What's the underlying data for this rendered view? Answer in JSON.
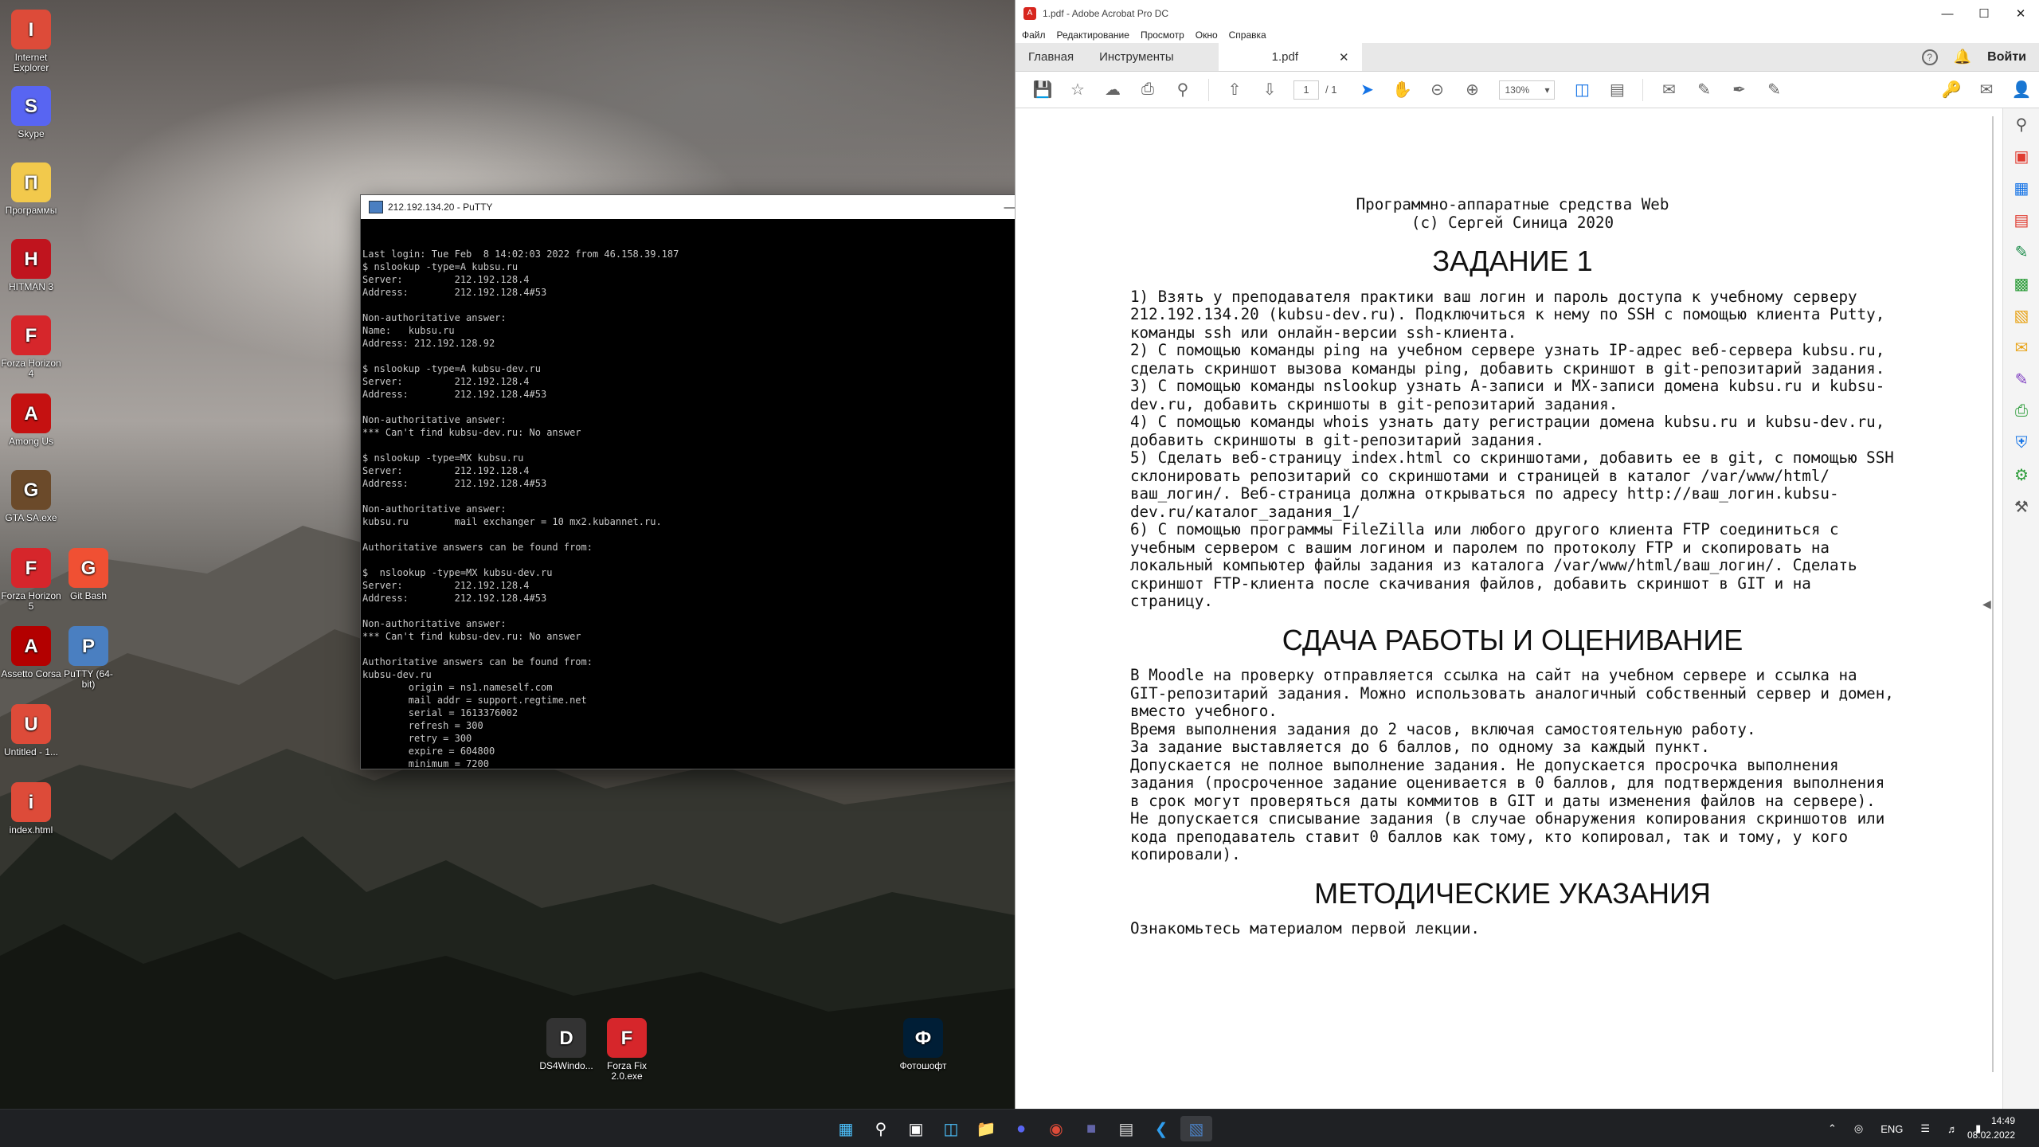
{
  "desktop": {
    "icons": [
      {
        "label": "Internet Explorer",
        "icon": "chrome-icon",
        "color": "#dd4b39"
      },
      {
        "label": "Skype",
        "icon": "discord-icon",
        "color": "#5865f2"
      },
      {
        "label": "Программы",
        "icon": "folder-icon",
        "color": "#f2c94c"
      },
      {
        "label": "HITMAN 3",
        "icon": "hitman-icon",
        "color": "#c0141e"
      },
      {
        "label": "Forza Horizon 4",
        "icon": "forza-icon",
        "color": "#d6262b"
      },
      {
        "label": "Among Us",
        "icon": "among-us-icon",
        "color": "#c51111"
      },
      {
        "label": "GTA SA.exe",
        "icon": "gta-icon",
        "color": "#6b4a2a"
      },
      {
        "label": "Forza Horizon 5",
        "icon": "forza-icon",
        "color": "#d6262b"
      },
      {
        "label": "Assetto Corsa",
        "icon": "assetto-icon",
        "color": "#b30000"
      },
      {
        "label": "Untitled - 1...",
        "icon": "chrome-icon",
        "color": "#dd4b39"
      },
      {
        "label": "index.html",
        "icon": "chrome-icon",
        "color": "#dd4b39"
      },
      {
        "label": "Git Bash",
        "icon": "git-icon",
        "color": "#f05033"
      },
      {
        "label": "PuTTY (64-bit)",
        "icon": "putty-icon",
        "color": "#4a7fc1"
      },
      {
        "label": "DS4Windo...",
        "icon": "ds4-icon",
        "color": "#333333"
      },
      {
        "label": "Forza Fix 2.0.exe",
        "icon": "forza-icon",
        "color": "#d6262b"
      },
      {
        "label": "Фотошофт",
        "icon": "photoshop-icon",
        "color": "#001e36"
      }
    ]
  },
  "putty": {
    "title": "212.192.134.20 - PuTTY",
    "lines": [
      "Last login: Tue Feb  8 14:02:03 2022 from 46.158.39.187",
      "$ nslookup -type=A kubsu.ru",
      "Server:         212.192.128.4",
      "Address:        212.192.128.4#53",
      "",
      "Non-authoritative answer:",
      "Name:   kubsu.ru",
      "Address: 212.192.128.92",
      "",
      "$ nslookup -type=A kubsu-dev.ru",
      "Server:         212.192.128.4",
      "Address:        212.192.128.4#53",
      "",
      "Non-authoritative answer:",
      "*** Can't find kubsu-dev.ru: No answer",
      "",
      "$ nslookup -type=MX kubsu.ru",
      "Server:         212.192.128.4",
      "Address:        212.192.128.4#53",
      "",
      "Non-authoritative answer:",
      "kubsu.ru        mail exchanger = 10 mx2.kubannet.ru.",
      "",
      "Authoritative answers can be found from:",
      "",
      "$  nslookup -type=MX kubsu-dev.ru",
      "Server:         212.192.128.4",
      "Address:        212.192.128.4#53",
      "",
      "Non-authoritative answer:",
      "*** Can't find kubsu-dev.ru: No answer",
      "",
      "Authoritative answers can be found from:",
      "kubsu-dev.ru",
      "        origin = ns1.nameself.com",
      "        mail addr = support.regtime.net",
      "        serial = 1613376002",
      "        refresh = 300",
      "        retry = 300",
      "        expire = 604800",
      "        minimum = 7200",
      ""
    ],
    "prompt": "$ "
  },
  "acrobat": {
    "title": "1.pdf - Adobe Acrobat Pro DC",
    "menu": [
      "Файл",
      "Редактирование",
      "Просмотр",
      "Окно",
      "Справка"
    ],
    "tabs": {
      "home": "Главная",
      "tools": "Инструменты",
      "doc": "1.pdf"
    },
    "sign_in": "Войти",
    "page_current": "1",
    "page_total": "/ 1",
    "zoom": "130%",
    "document": {
      "header_line1": "Программно-аппаратные средства Web",
      "header_line2": "(c) Сергей Синица 2020",
      "h1": "ЗАДАНИЕ 1",
      "task_text": "1) Взять у преподавателя практики ваш логин и пароль доступа к учебному серверу 212.192.134.20 (kubsu-dev.ru). Подключиться к нему по SSH с помощью клиента Putty, команды ssh или онлайн-версии ssh-клиента.\n2) С помощью команды ping на учебном сервере узнать IP-адрес веб-сервера kubsu.ru, сделать скриншот вызова команды ping, добавить скриншот в git-репозитарий задания.\n3) С помощью команды nslookup узнать A-записи и MX-записи домена kubsu.ru и kubsu-dev.ru, добавить скриншоты в git-репозитарий задания.\n4) С помощью команды whois узнать дату регистрации домена kubsu.ru и kubsu-dev.ru, добавить скриншоты в git-репозитарий задания.\n5) Сделать веб-страницу index.html со скриншотами, добавить ее в git, с помощью SSH склонировать репозитарий со скриншотами и страницей в каталог /var/www/html/ваш_логин/. Веб-страница должна открываться по адресу http://ваш_логин.kubsu-dev.ru/каталог_задания_1/\n6) С помощью программы FileZilla или любого другого клиента FTP соединиться с учебным сервером с вашим логином и паролем по протоколу FTP и скопировать на локальный компьютер файлы задания из каталога /var/www/html/ваш_логин/. Сделать скриншот FTP-клиента после скачивания файлов, добавить скриншот в GIT и на страницу.",
      "h2": "СДАЧА РАБОТЫ И ОЦЕНИВАНИЕ",
      "grading_text": "В Moodle на проверку отправляется ссылка на сайт на учебном сервере и ссылка на GIT-репозитарий задания. Можно использовать аналогичный собственный сервер и домен, вместо учебного.\nВремя выполнения задания до 2 часов, включая самостоятельную работу.\nЗа задание выставляется до 6 баллов, по одному за каждый пункт.\nДопускается не полное выполнение задания. Не допускается просрочка выполнения задания (просроченное задание оценивается в 0 баллов, для подтверждения выполнения в срок могут проверяться даты коммитов в GIT и даты изменения файлов на сервере). Не допускается списывание задания (в случае обнаружения копирования скриншотов или кода преподаватель ставит 0 баллов как тому, кто копировал, так и тому, у кого копировали).",
      "h3": "МЕТОДИЧЕСКИЕ УКАЗАНИЯ",
      "method_text": "Ознакомьтесь материалом первой лекции."
    }
  },
  "taskbar": {
    "lang": "ENG",
    "time": "14:49",
    "date": "08.02.2022"
  }
}
